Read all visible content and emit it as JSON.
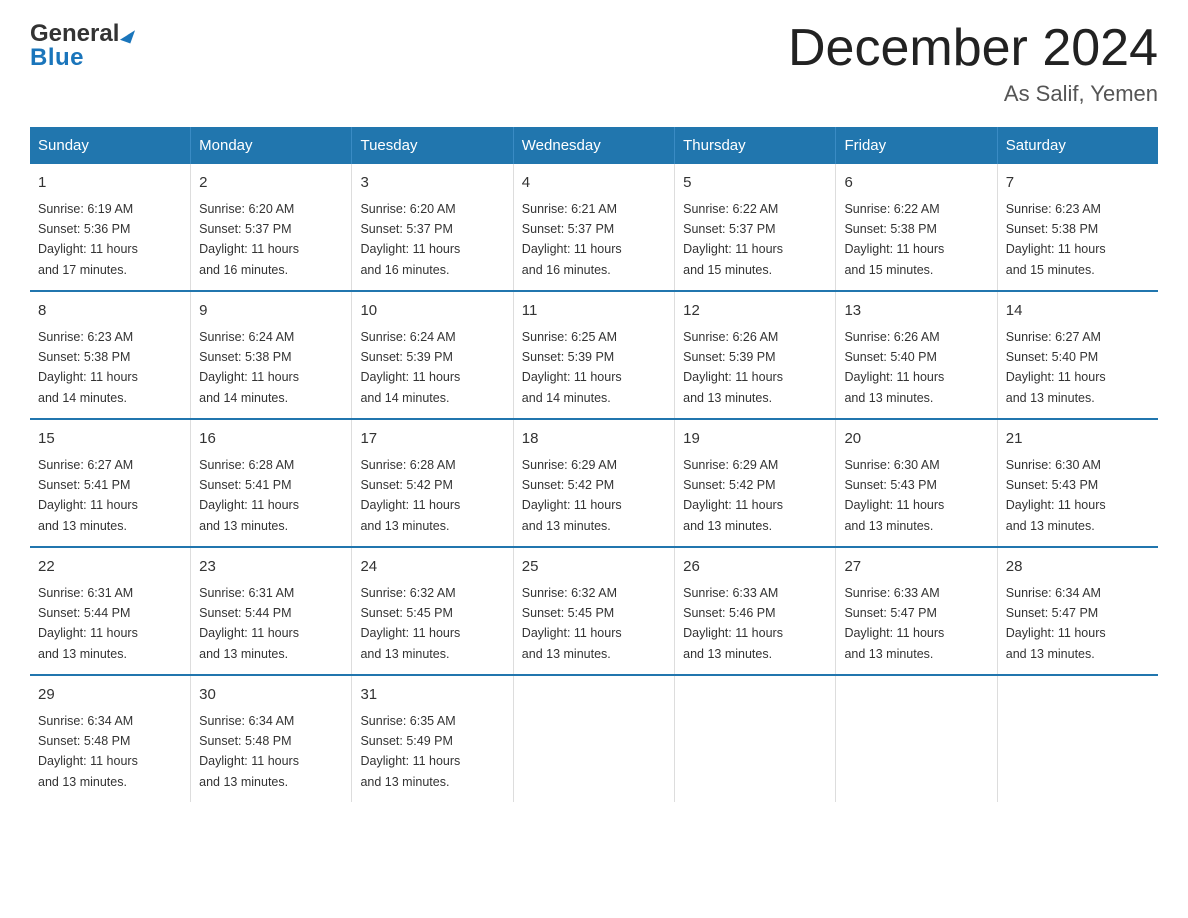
{
  "logo": {
    "line1": "General",
    "triangle": "▶",
    "line2": "Blue"
  },
  "title": "December 2024",
  "subtitle": "As Salif, Yemen",
  "days_header": [
    "Sunday",
    "Monday",
    "Tuesday",
    "Wednesday",
    "Thursday",
    "Friday",
    "Saturday"
  ],
  "weeks": [
    [
      {
        "num": "1",
        "sunrise": "6:19 AM",
        "sunset": "5:36 PM",
        "daylight": "11 hours and 17 minutes."
      },
      {
        "num": "2",
        "sunrise": "6:20 AM",
        "sunset": "5:37 PM",
        "daylight": "11 hours and 16 minutes."
      },
      {
        "num": "3",
        "sunrise": "6:20 AM",
        "sunset": "5:37 PM",
        "daylight": "11 hours and 16 minutes."
      },
      {
        "num": "4",
        "sunrise": "6:21 AM",
        "sunset": "5:37 PM",
        "daylight": "11 hours and 16 minutes."
      },
      {
        "num": "5",
        "sunrise": "6:22 AM",
        "sunset": "5:37 PM",
        "daylight": "11 hours and 15 minutes."
      },
      {
        "num": "6",
        "sunrise": "6:22 AM",
        "sunset": "5:38 PM",
        "daylight": "11 hours and 15 minutes."
      },
      {
        "num": "7",
        "sunrise": "6:23 AM",
        "sunset": "5:38 PM",
        "daylight": "11 hours and 15 minutes."
      }
    ],
    [
      {
        "num": "8",
        "sunrise": "6:23 AM",
        "sunset": "5:38 PM",
        "daylight": "11 hours and 14 minutes."
      },
      {
        "num": "9",
        "sunrise": "6:24 AM",
        "sunset": "5:38 PM",
        "daylight": "11 hours and 14 minutes."
      },
      {
        "num": "10",
        "sunrise": "6:24 AM",
        "sunset": "5:39 PM",
        "daylight": "11 hours and 14 minutes."
      },
      {
        "num": "11",
        "sunrise": "6:25 AM",
        "sunset": "5:39 PM",
        "daylight": "11 hours and 14 minutes."
      },
      {
        "num": "12",
        "sunrise": "6:26 AM",
        "sunset": "5:39 PM",
        "daylight": "11 hours and 13 minutes."
      },
      {
        "num": "13",
        "sunrise": "6:26 AM",
        "sunset": "5:40 PM",
        "daylight": "11 hours and 13 minutes."
      },
      {
        "num": "14",
        "sunrise": "6:27 AM",
        "sunset": "5:40 PM",
        "daylight": "11 hours and 13 minutes."
      }
    ],
    [
      {
        "num": "15",
        "sunrise": "6:27 AM",
        "sunset": "5:41 PM",
        "daylight": "11 hours and 13 minutes."
      },
      {
        "num": "16",
        "sunrise": "6:28 AM",
        "sunset": "5:41 PM",
        "daylight": "11 hours and 13 minutes."
      },
      {
        "num": "17",
        "sunrise": "6:28 AM",
        "sunset": "5:42 PM",
        "daylight": "11 hours and 13 minutes."
      },
      {
        "num": "18",
        "sunrise": "6:29 AM",
        "sunset": "5:42 PM",
        "daylight": "11 hours and 13 minutes."
      },
      {
        "num": "19",
        "sunrise": "6:29 AM",
        "sunset": "5:42 PM",
        "daylight": "11 hours and 13 minutes."
      },
      {
        "num": "20",
        "sunrise": "6:30 AM",
        "sunset": "5:43 PM",
        "daylight": "11 hours and 13 minutes."
      },
      {
        "num": "21",
        "sunrise": "6:30 AM",
        "sunset": "5:43 PM",
        "daylight": "11 hours and 13 minutes."
      }
    ],
    [
      {
        "num": "22",
        "sunrise": "6:31 AM",
        "sunset": "5:44 PM",
        "daylight": "11 hours and 13 minutes."
      },
      {
        "num": "23",
        "sunrise": "6:31 AM",
        "sunset": "5:44 PM",
        "daylight": "11 hours and 13 minutes."
      },
      {
        "num": "24",
        "sunrise": "6:32 AM",
        "sunset": "5:45 PM",
        "daylight": "11 hours and 13 minutes."
      },
      {
        "num": "25",
        "sunrise": "6:32 AM",
        "sunset": "5:45 PM",
        "daylight": "11 hours and 13 minutes."
      },
      {
        "num": "26",
        "sunrise": "6:33 AM",
        "sunset": "5:46 PM",
        "daylight": "11 hours and 13 minutes."
      },
      {
        "num": "27",
        "sunrise": "6:33 AM",
        "sunset": "5:47 PM",
        "daylight": "11 hours and 13 minutes."
      },
      {
        "num": "28",
        "sunrise": "6:34 AM",
        "sunset": "5:47 PM",
        "daylight": "11 hours and 13 minutes."
      }
    ],
    [
      {
        "num": "29",
        "sunrise": "6:34 AM",
        "sunset": "5:48 PM",
        "daylight": "11 hours and 13 minutes."
      },
      {
        "num": "30",
        "sunrise": "6:34 AM",
        "sunset": "5:48 PM",
        "daylight": "11 hours and 13 minutes."
      },
      {
        "num": "31",
        "sunrise": "6:35 AM",
        "sunset": "5:49 PM",
        "daylight": "11 hours and 13 minutes."
      },
      null,
      null,
      null,
      null
    ]
  ],
  "cell_labels": {
    "sunrise": "Sunrise:",
    "sunset": "Sunset:",
    "daylight": "Daylight:"
  }
}
